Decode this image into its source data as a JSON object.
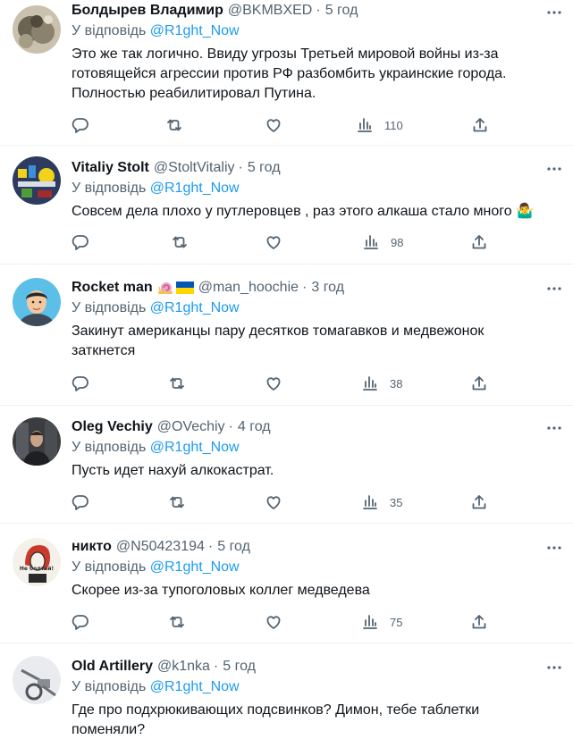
{
  "reply_prefix": "У відповідь",
  "tweets": [
    {
      "name": "Болдырев Владимир",
      "handle": "@BKMBXED",
      "separator": "·",
      "time": "5 год",
      "reply_to": "@R1ght_Now",
      "text": "Это же так логично. Ввиду угрозы Третьей мировой войны из-за готовящейся агрессии против РФ разбомбить украинские города. Полностью реабилитировал Путина.",
      "views": "110"
    },
    {
      "name": "Vitaliy Stolt",
      "handle": "@StoltVitaliy",
      "separator": "·",
      "time": "5 год",
      "reply_to": "@R1ght_Now",
      "text": "Совсем дела плохо у путлеровцев , раз этого алкаша стало много 🤷‍♂️",
      "views": "98"
    },
    {
      "name": "Rocket man",
      "name_emoji": "🐌🇺🇦",
      "handle": "@man_hoochie",
      "separator": "·",
      "time": "3 год",
      "reply_to": "@R1ght_Now",
      "text": "Закинут американцы пару десятков томагавков и медвежонок заткнется",
      "views": "38"
    },
    {
      "name": "Oleg Vechiy",
      "handle": "@OVechiy",
      "separator": "·",
      "time": "4 год",
      "reply_to": "@R1ght_Now",
      "text": "Пусть идет нахуй алкокастрат.",
      "views": "35"
    },
    {
      "name": "никто",
      "handle": "@N50423194",
      "separator": "·",
      "time": "5 год",
      "reply_to": "@R1ght_Now",
      "text": "Скорее из-за тупоголовых коллег медведева",
      "views": "75",
      "avatar_text": "Не болтай!"
    },
    {
      "name": "Old Artillery",
      "handle": "@k1nka",
      "separator": "·",
      "time": "5 год",
      "reply_to": "@R1ght_Now",
      "text": "Где про подхрюкивающих подсвинков? Димон, тебе таблетки поменяли?",
      "views": ""
    }
  ],
  "colors": {
    "text_primary": "#0f1419",
    "text_secondary": "#536471",
    "accent": "#1d9bf0",
    "divider": "#eff3f4"
  },
  "icons": {
    "reply": "speech-bubble-icon",
    "retweet": "retweet-arrows-icon",
    "like": "heart-icon",
    "views": "bar-chart-icon",
    "share": "share-upload-icon",
    "more": "three-dots-icon"
  }
}
